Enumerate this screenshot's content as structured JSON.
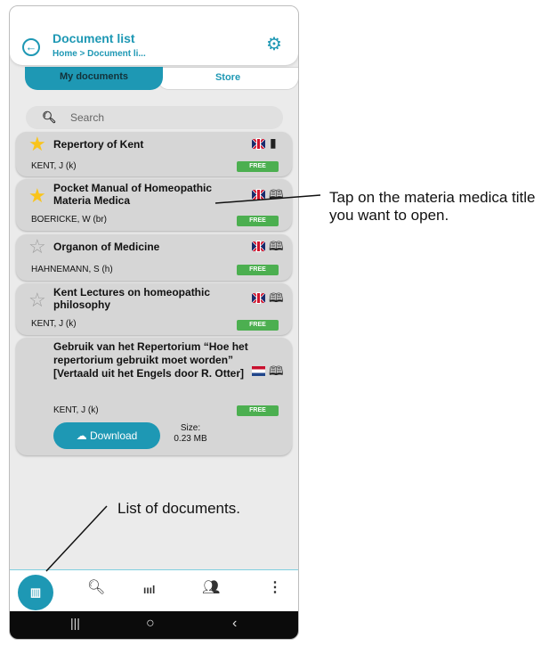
{
  "header": {
    "title": "Document list",
    "breadcrumb": "Home > Document li...",
    "back_icon": "back-arrow-icon",
    "settings_icon": "gear-icon"
  },
  "tabs": [
    {
      "label": "My documents",
      "active": true
    },
    {
      "label": "Store",
      "active": false
    }
  ],
  "search": {
    "placeholder": "Search"
  },
  "documents": [
    {
      "title": "Repertory of Kent",
      "author": "KENT, J (k)",
      "badge": "FREE",
      "starred": true,
      "language": "en"
    },
    {
      "title": "Pocket Manual of Homeopathic Materia Medica",
      "author": "BOERICKE, W (br)",
      "badge": "FREE",
      "starred": true,
      "language": "en"
    },
    {
      "title": "Organon of Medicine",
      "author": "HAHNEMANN, S (h)",
      "badge": "FREE",
      "starred": false,
      "language": "en"
    },
    {
      "title": "Kent Lectures on homeopathic philosophy",
      "author": "KENT, J (k)",
      "badge": "FREE",
      "starred": false,
      "language": "en"
    },
    {
      "title": "Gebruik van het Repertorium “Hoe het repertorium gebruikt moet worden” [Vertaald uit het Engels door R. Otter]",
      "author": "KENT, J (k)",
      "badge": "FREE",
      "starred": false,
      "language": "nl",
      "download_label": "Download",
      "size_label": "Size:",
      "size_value": "0.23 MB"
    }
  ],
  "bottom_nav": [
    "library-icon",
    "search-icon",
    "signal-icon",
    "users-icon",
    "more-icon"
  ],
  "annotations": {
    "tap_title": "Tap on the materia medica title you want to open.",
    "list_docs": "List of documents."
  },
  "colors": {
    "accent": "#1e98b4",
    "free_badge": "#4caf50",
    "star": "#f9c41b"
  }
}
